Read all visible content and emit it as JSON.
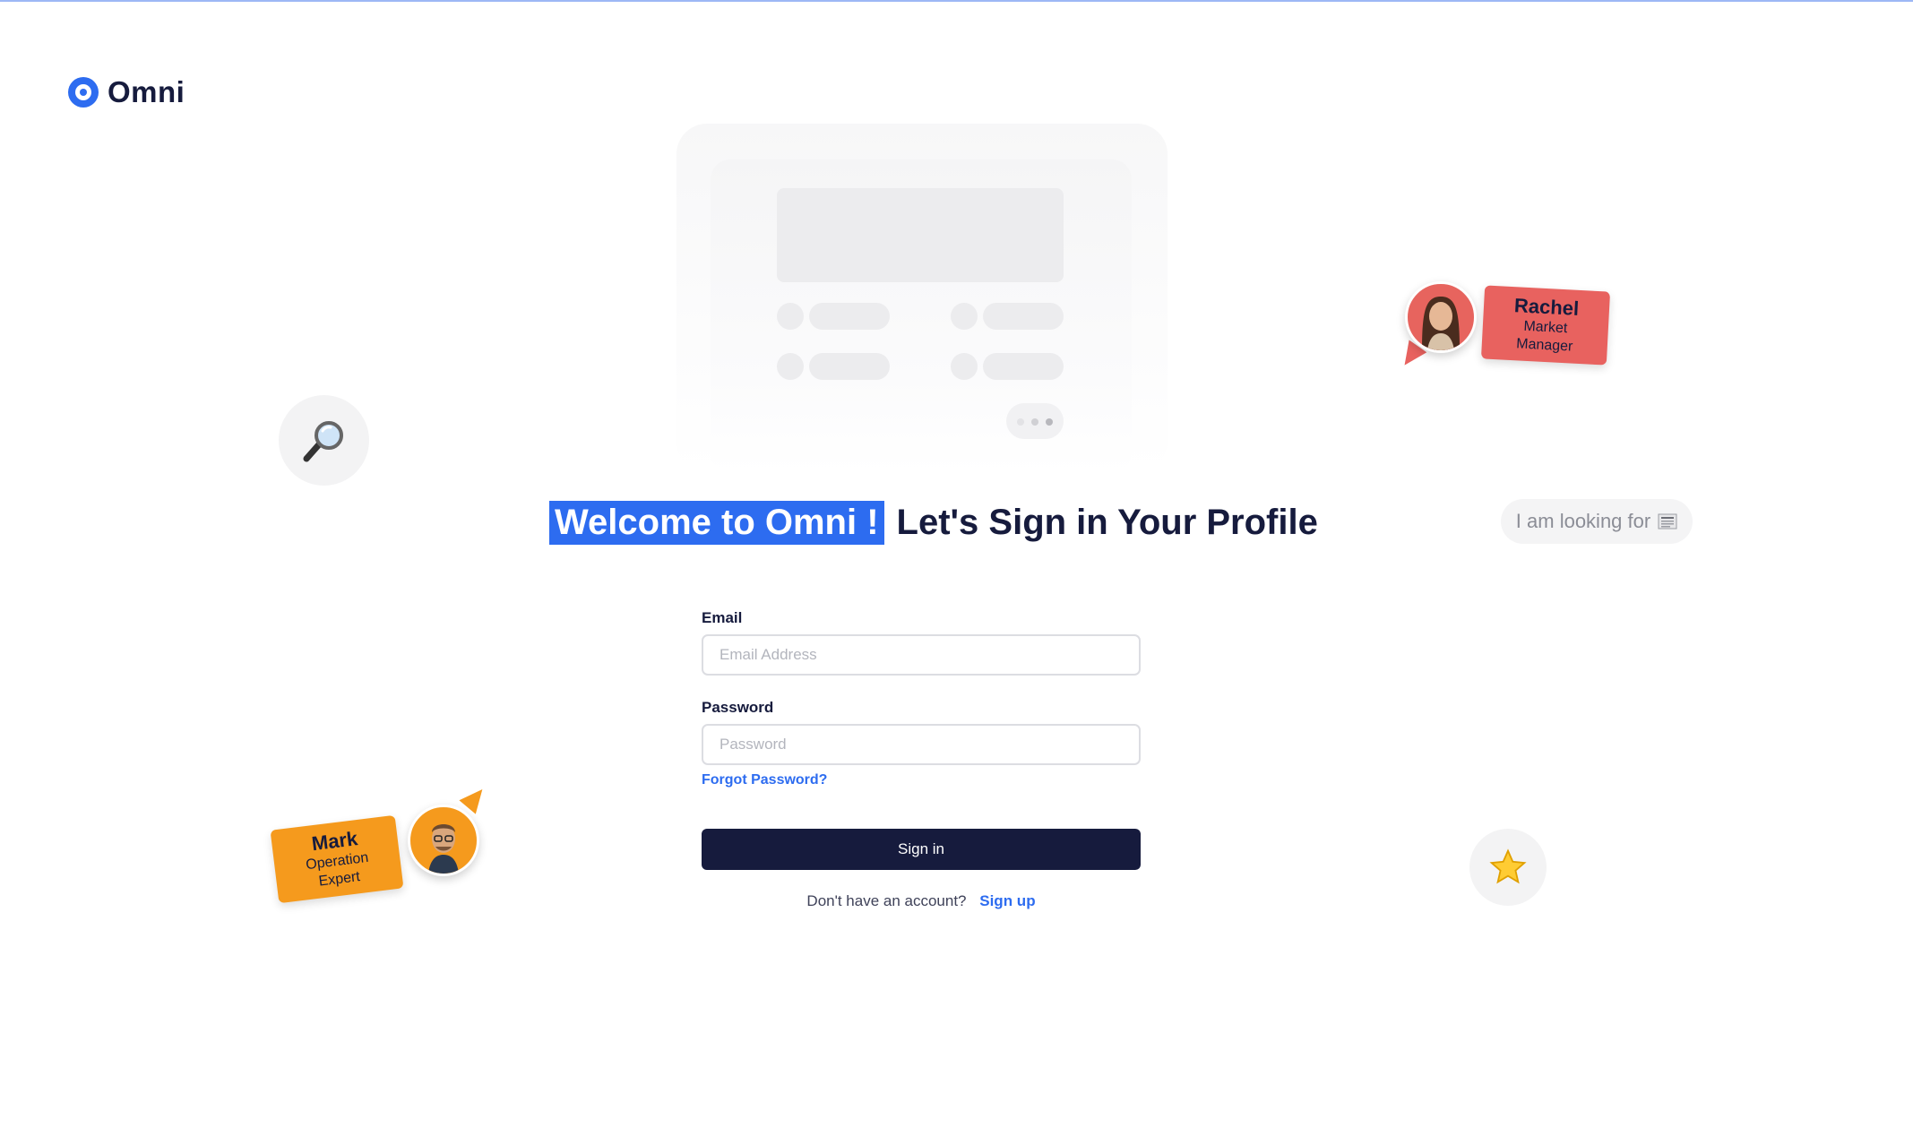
{
  "brand": {
    "name": "Omni",
    "color": "#2d6cf0"
  },
  "heading": {
    "highlight": "Welcome to Omni !",
    "rest": "Let's Sign in Your Profile"
  },
  "form": {
    "email_label": "Email",
    "email_placeholder": "Email Address",
    "password_label": "Password",
    "password_placeholder": "Password",
    "forgot_link": "Forgot Password?",
    "submit_label": "Sign in",
    "signup_prompt": "Don't have an account?",
    "signup_link": "Sign up"
  },
  "decorations": {
    "looking_for_text": "I am looking for",
    "looking_for_icon": "newspaper-icon",
    "search_icon": "magnifier-icon",
    "star_icon": "star-icon",
    "personas": [
      {
        "name": "Rachel",
        "role": "Market Manager",
        "color": "#e8625f"
      },
      {
        "name": "Mark",
        "role": "Operation Expert",
        "color": "#f59a1d"
      }
    ]
  },
  "colors": {
    "navy": "#161b3d",
    "accent": "#2d6cf0"
  }
}
